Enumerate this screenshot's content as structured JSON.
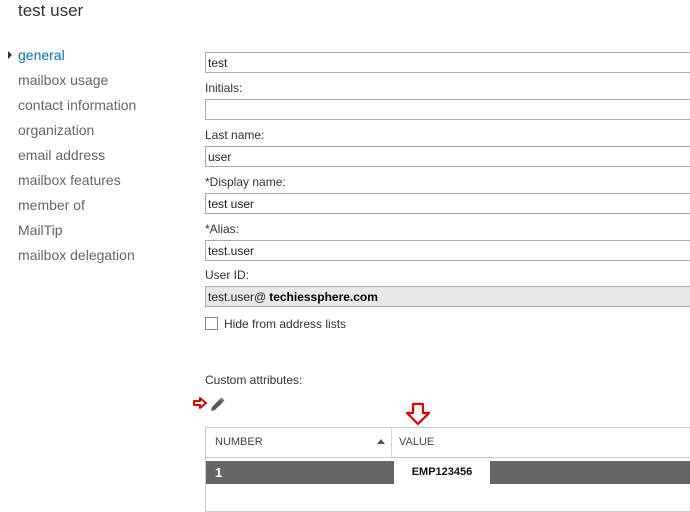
{
  "page": {
    "title": "test user"
  },
  "nav": {
    "items": [
      {
        "label": "general"
      },
      {
        "label": "mailbox usage"
      },
      {
        "label": "contact information"
      },
      {
        "label": "organization"
      },
      {
        "label": "email address"
      },
      {
        "label": "mailbox features"
      },
      {
        "label": "member of"
      },
      {
        "label": "MailTip"
      },
      {
        "label": "mailbox delegation"
      }
    ]
  },
  "form": {
    "first_name_value": "test",
    "initials_label": "Initials:",
    "initials_value": "",
    "last_name_label": "Last name:",
    "last_name_value": "user",
    "display_name_label": "*Display name:",
    "display_name_value": "test user",
    "alias_label": "*Alias:",
    "alias_value": "test.user",
    "user_id_label": "User ID:",
    "user_id_value": "test.user@",
    "user_id_domain": "techiessphere.com",
    "hide_label": "Hide from address lists",
    "custom_attributes_label": "Custom attributes:"
  },
  "table": {
    "col_number": "NUMBER",
    "col_value": "VALUE",
    "rows": [
      {
        "number": "1",
        "value": "EMP123456"
      }
    ]
  },
  "colors": {
    "accent": "#0072c6",
    "annotation": "#e00000",
    "selected_row": "#666666"
  }
}
